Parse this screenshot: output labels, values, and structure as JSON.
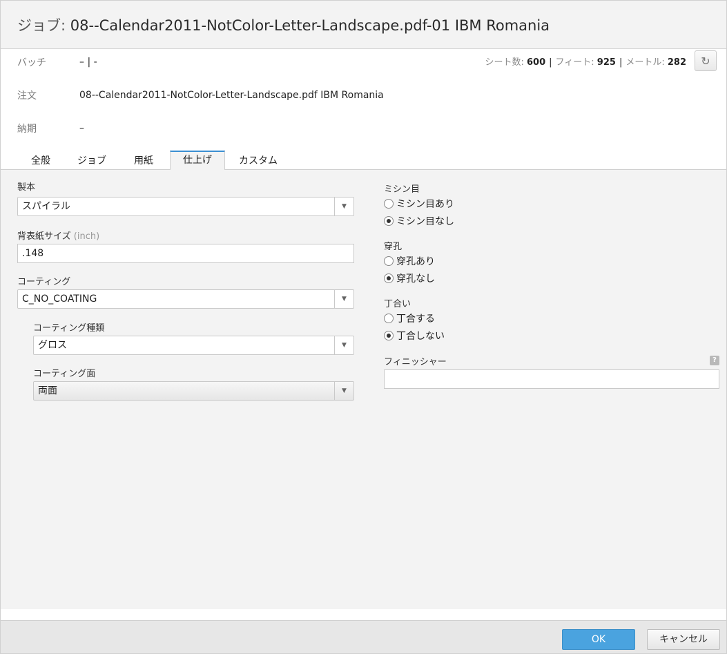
{
  "dialog": {
    "title_prefix": "ジョブ:",
    "title": "08--Calendar2011-NotColor-Letter-Landscape.pdf-01 IBM Romania"
  },
  "info": {
    "batch_label": "バッチ",
    "batch_value": "– | -",
    "order_label": "注文",
    "order_value": "08--Calendar2011-NotColor-Letter-Landscape.pdf IBM Romania",
    "due_label": "納期",
    "due_value": "–"
  },
  "stats": {
    "sheets_label": "シート数:",
    "sheets_value": "600",
    "feet_label": "フィート:",
    "feet_value": "925",
    "meters_label": "メートル:",
    "meters_value": "282",
    "separator": "|"
  },
  "tabs": [
    {
      "label": "全般"
    },
    {
      "label": "ジョブ"
    },
    {
      "label": "用紙"
    },
    {
      "label": "仕上げ",
      "active": true
    },
    {
      "label": "カスタム"
    }
  ],
  "finishing": {
    "binding_label": "製本",
    "binding_value": "スパイラル",
    "spine_label": "背表紙サイズ",
    "spine_unit": "(inch)",
    "spine_value": ".148",
    "coating_label": "コーティング",
    "coating_value": "C_NO_COATING",
    "coating_type_label": "コーティング種類",
    "coating_type_value": "グロス",
    "coating_side_label": "コーティング面",
    "coating_side_value": "両面",
    "perforation_label": "ミシン目",
    "perforation_yes": "ミシン目あり",
    "perforation_no": "ミシン目なし",
    "punch_label": "穿孔",
    "punch_yes": "穿孔あり",
    "punch_no": "穿孔なし",
    "collate_label": "丁合い",
    "collate_yes": "丁合する",
    "collate_no": "丁合しない",
    "finisher_label": "フィニッシャー",
    "finisher_value": ""
  },
  "buttons": {
    "ok": "OK",
    "cancel": "キャンセル"
  }
}
